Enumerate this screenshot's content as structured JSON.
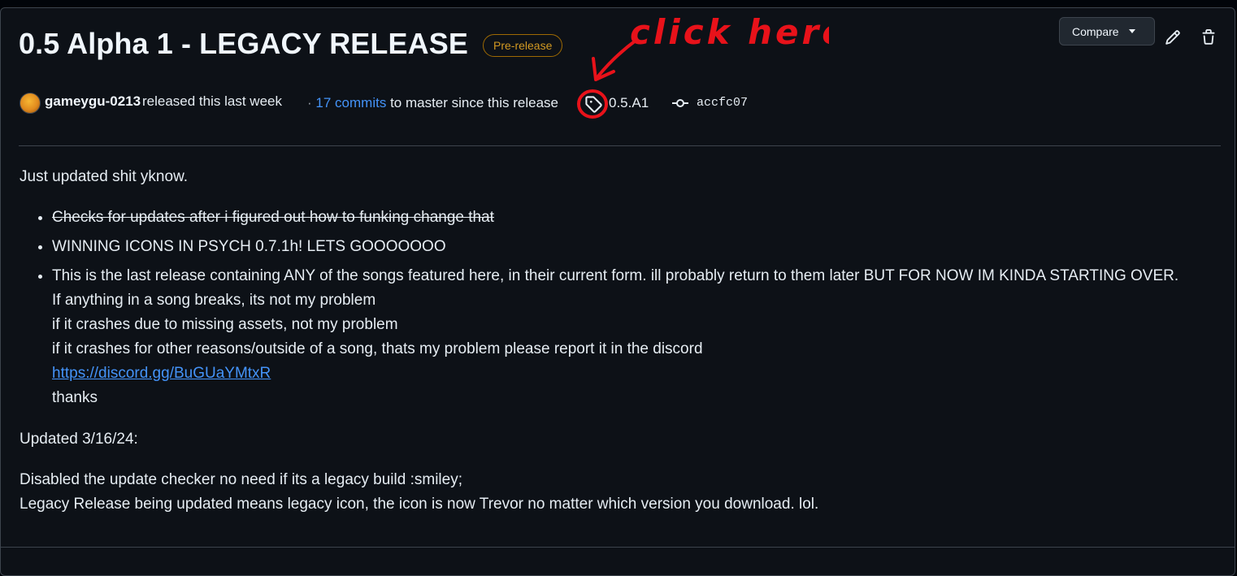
{
  "release": {
    "title": "0.5 Alpha 1 - LEGACY RELEASE",
    "badge": "Pre-release",
    "compare_label": "Compare",
    "author": "gameygu-0213",
    "released_text": "released this last week",
    "separator": "·",
    "commits_link": "17 commits",
    "commits_suffix": "to master since this release",
    "tag": "0.5.A1",
    "commit_hash": "accfc07"
  },
  "annotation": {
    "text": "click here",
    "color": "#e8121a"
  },
  "notes": {
    "intro": "Just updated shit yknow.",
    "items": [
      "Checks for updates after i figured out how to funking change that",
      "WINNING ICONS IN PSYCH 0.7.1h! LETS GOOOOOOO",
      "This is the last release containing ANY of the songs featured here, in their current form. ill probably return to them later BUT FOR NOW IM KINDA STARTING OVER."
    ],
    "item3_lines": [
      "If anything in a song breaks, its not my problem",
      "if it crashes due to missing assets, not my problem",
      "if it crashes for other reasons/outside of a song, thats my problem please report it in the discord"
    ],
    "discord_link": "https://discord.gg/BuGUaYMtxR",
    "thanks": "thanks",
    "updated_heading": "Updated 3/16/24:",
    "final_line1": "Disabled the update checker no need if its a legacy build :smiley;",
    "final_line2": "Legacy Release being updated means legacy icon, the icon is now Trevor no matter which version you download. lol."
  },
  "colors": {
    "background": "#0d1117",
    "accent_link": "#4493f8",
    "badge": "#d29922",
    "annotation": "#e8121a"
  }
}
